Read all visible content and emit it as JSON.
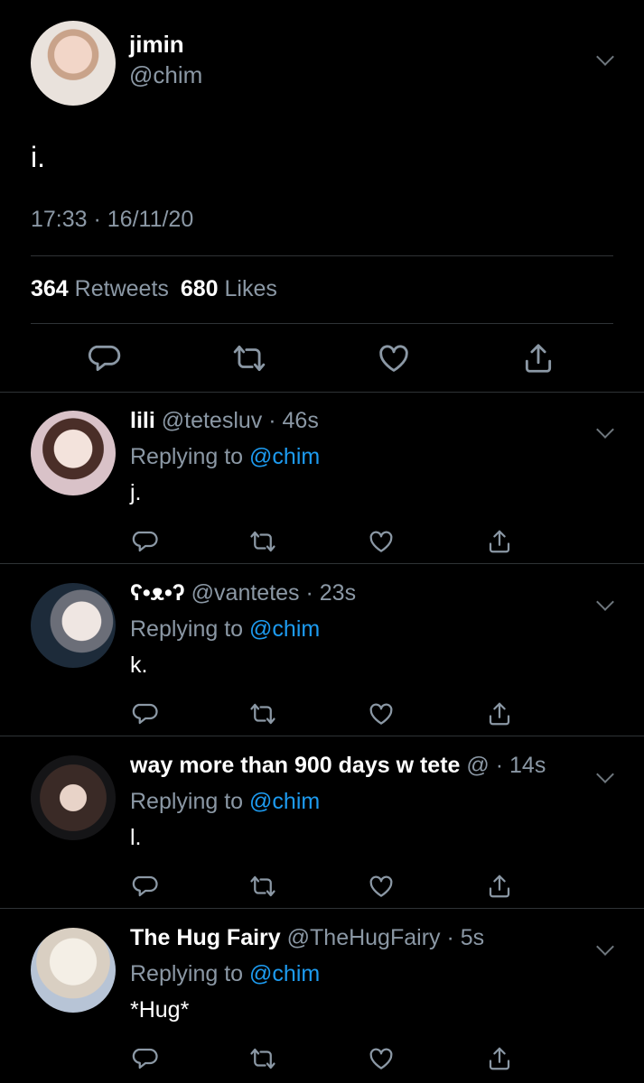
{
  "main": {
    "name": "jimin",
    "handle": "@chim",
    "text": "i.",
    "time": "17:33 · 16/11/20",
    "retweets_count": "364",
    "retweets_label": "Retweets",
    "likes_count": "680",
    "likes_label": "Likes"
  },
  "replies": [
    {
      "name": "lili",
      "handle": "@tetesluv",
      "time": "· 46s",
      "replying_label": "Replying to",
      "replying_handle": "@chim",
      "text": "j."
    },
    {
      "name": "ʕ•ᴥ•ʔ",
      "handle": "@vantetes",
      "time": "· 23s",
      "replying_label": "Replying to",
      "replying_handle": "@chim",
      "text": "k."
    },
    {
      "name": "way more than 900 days w tete",
      "handle": "@",
      "time": "· 14s",
      "replying_label": "Replying to",
      "replying_handle": "@chim",
      "text": "l."
    },
    {
      "name": "The Hug Fairy",
      "handle": "@TheHugFairy",
      "time": "· 5s",
      "replying_label": "Replying to",
      "replying_handle": "@chim",
      "text": "*Hug*"
    }
  ],
  "icons": {
    "reply": "reply-icon",
    "retweet": "retweet-icon",
    "like": "like-icon",
    "share": "share-icon",
    "more": "chevron-down-icon"
  },
  "colors": {
    "background": "#000000",
    "secondary": "#8b98a5",
    "link": "#1d9bf0",
    "divider": "#2f3336"
  }
}
